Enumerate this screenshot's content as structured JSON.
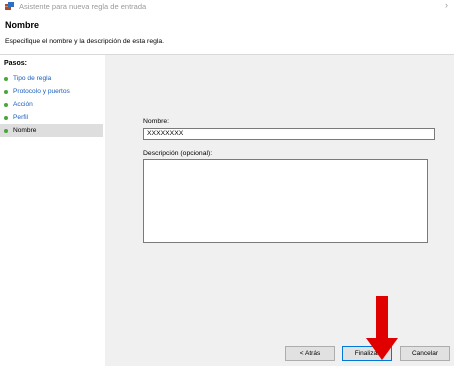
{
  "window": {
    "title": "Asistente para nueva regla de entrada",
    "close_glyph": "›"
  },
  "header": {
    "title": "Nombre",
    "subtitle": "Especifique el nombre y la descripción de esta regla."
  },
  "steps": {
    "heading": "Pasos:",
    "items": [
      {
        "label": "Tipo de regla"
      },
      {
        "label": "Protocolo y puertos"
      },
      {
        "label": "Acción"
      },
      {
        "label": "Perfil"
      },
      {
        "label": "Nombre",
        "current": true
      }
    ]
  },
  "form": {
    "name_label": "Nombre:",
    "name_value": "XXXXXXXX",
    "description_label": "Descripción (opcional):",
    "description_value": ""
  },
  "buttons": {
    "back": "< Atrás",
    "finish": "Finalizar",
    "cancel": "Cancelar"
  },
  "colors": {
    "accent": "#0078d7",
    "link": "#1a5fbf",
    "step_dot": "#4aa63a",
    "annotation_arrow": "#e00000"
  },
  "icons": {
    "app": "firewall-icon",
    "step_marker": "green-dot-icon",
    "annotation": "red-arrow-icon"
  }
}
